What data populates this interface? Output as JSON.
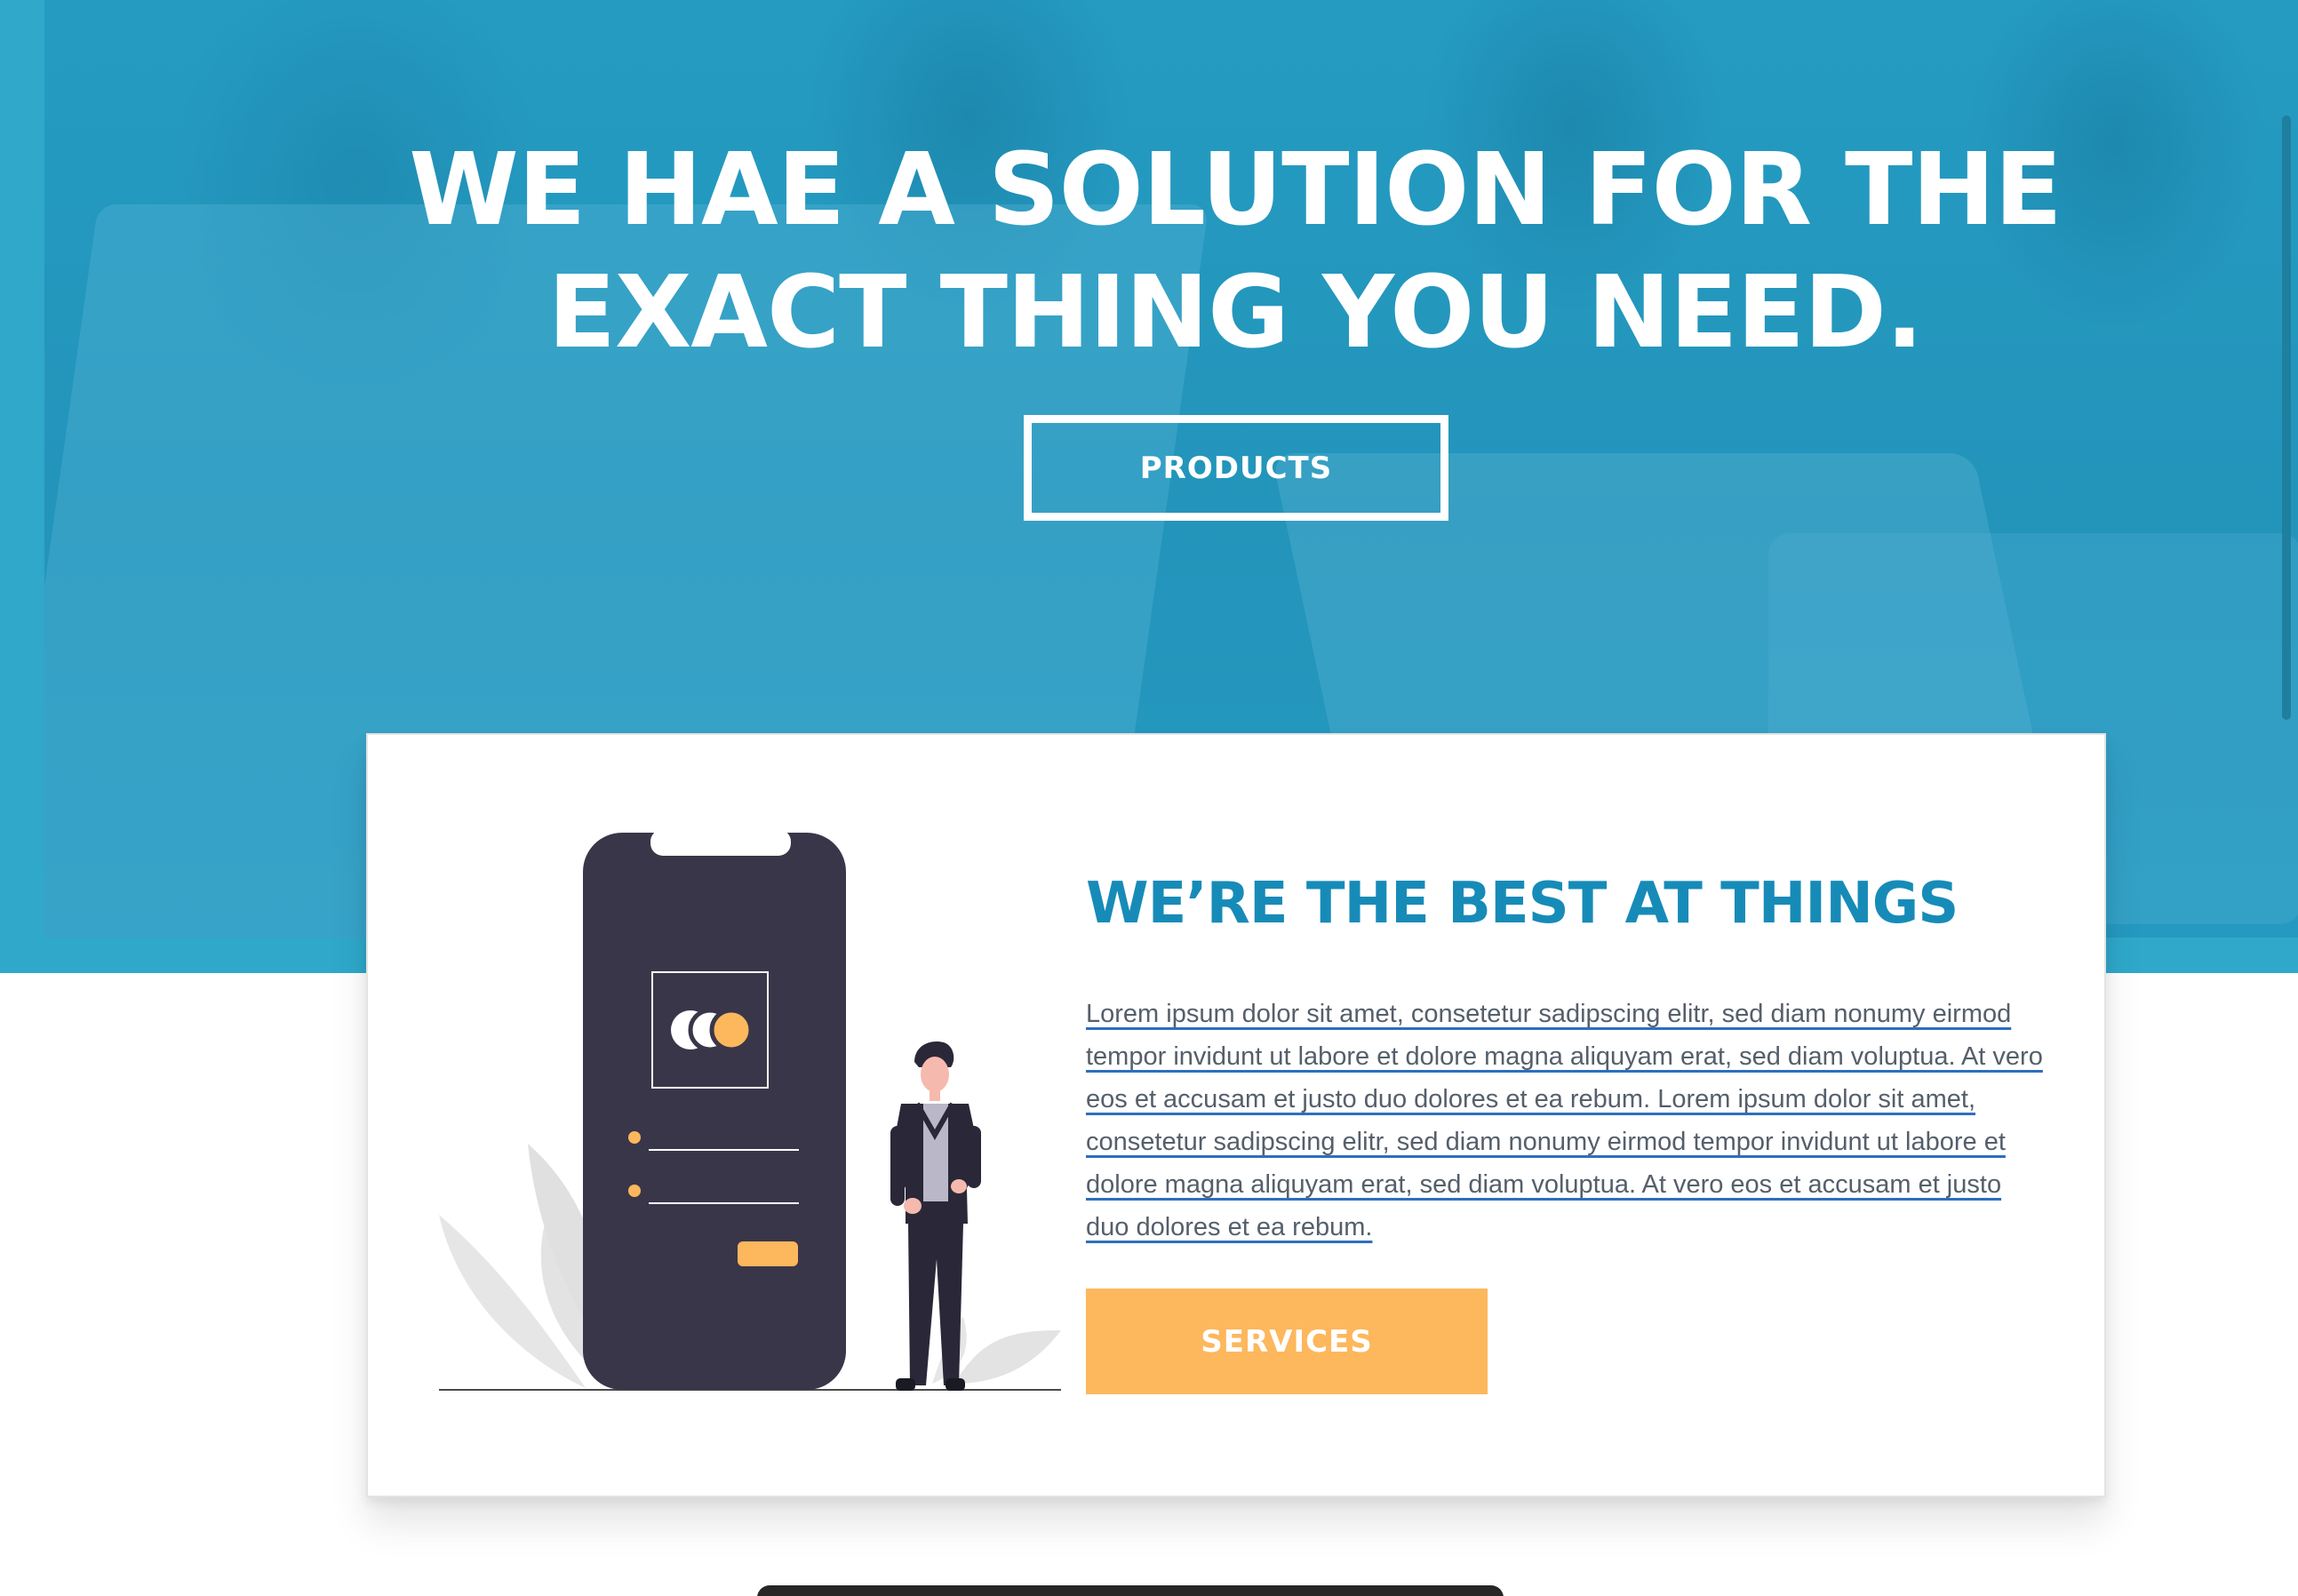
{
  "hero": {
    "title": "WE HAE A SOLUTION FOR THE EXACT THING YOU NEED.",
    "products_label": "PRODUCTS"
  },
  "about": {
    "heading": "WE’RE THE BEST AT THINGS",
    "body": "Lorem ipsum dolor sit amet, consetetur sadipscing elitr, sed diam nonumy eirmod tempor invidunt ut labore et dolore magna aliquyam erat, sed diam voluptua. At vero eos et accusam et justo duo dolores et ea rebum. Lorem ipsum dolor sit amet, consetetur sadipscing elitr, sed diam nonumy eirmod tempor invidunt ut labore et dolore magna aliquyam erat, sed diam voluptua. At vero eos et accusam et justo duo dolores et ea rebum.",
    "services_label": "SERVICES"
  },
  "icons": {
    "illustration": "person-with-phone-illustration",
    "payment": "card-payment-icon"
  },
  "colors": {
    "hero_overlay": "#2fa8ca",
    "heading": "#178bb8",
    "services_button": "#fdb75d",
    "phone": "#3a3649"
  }
}
